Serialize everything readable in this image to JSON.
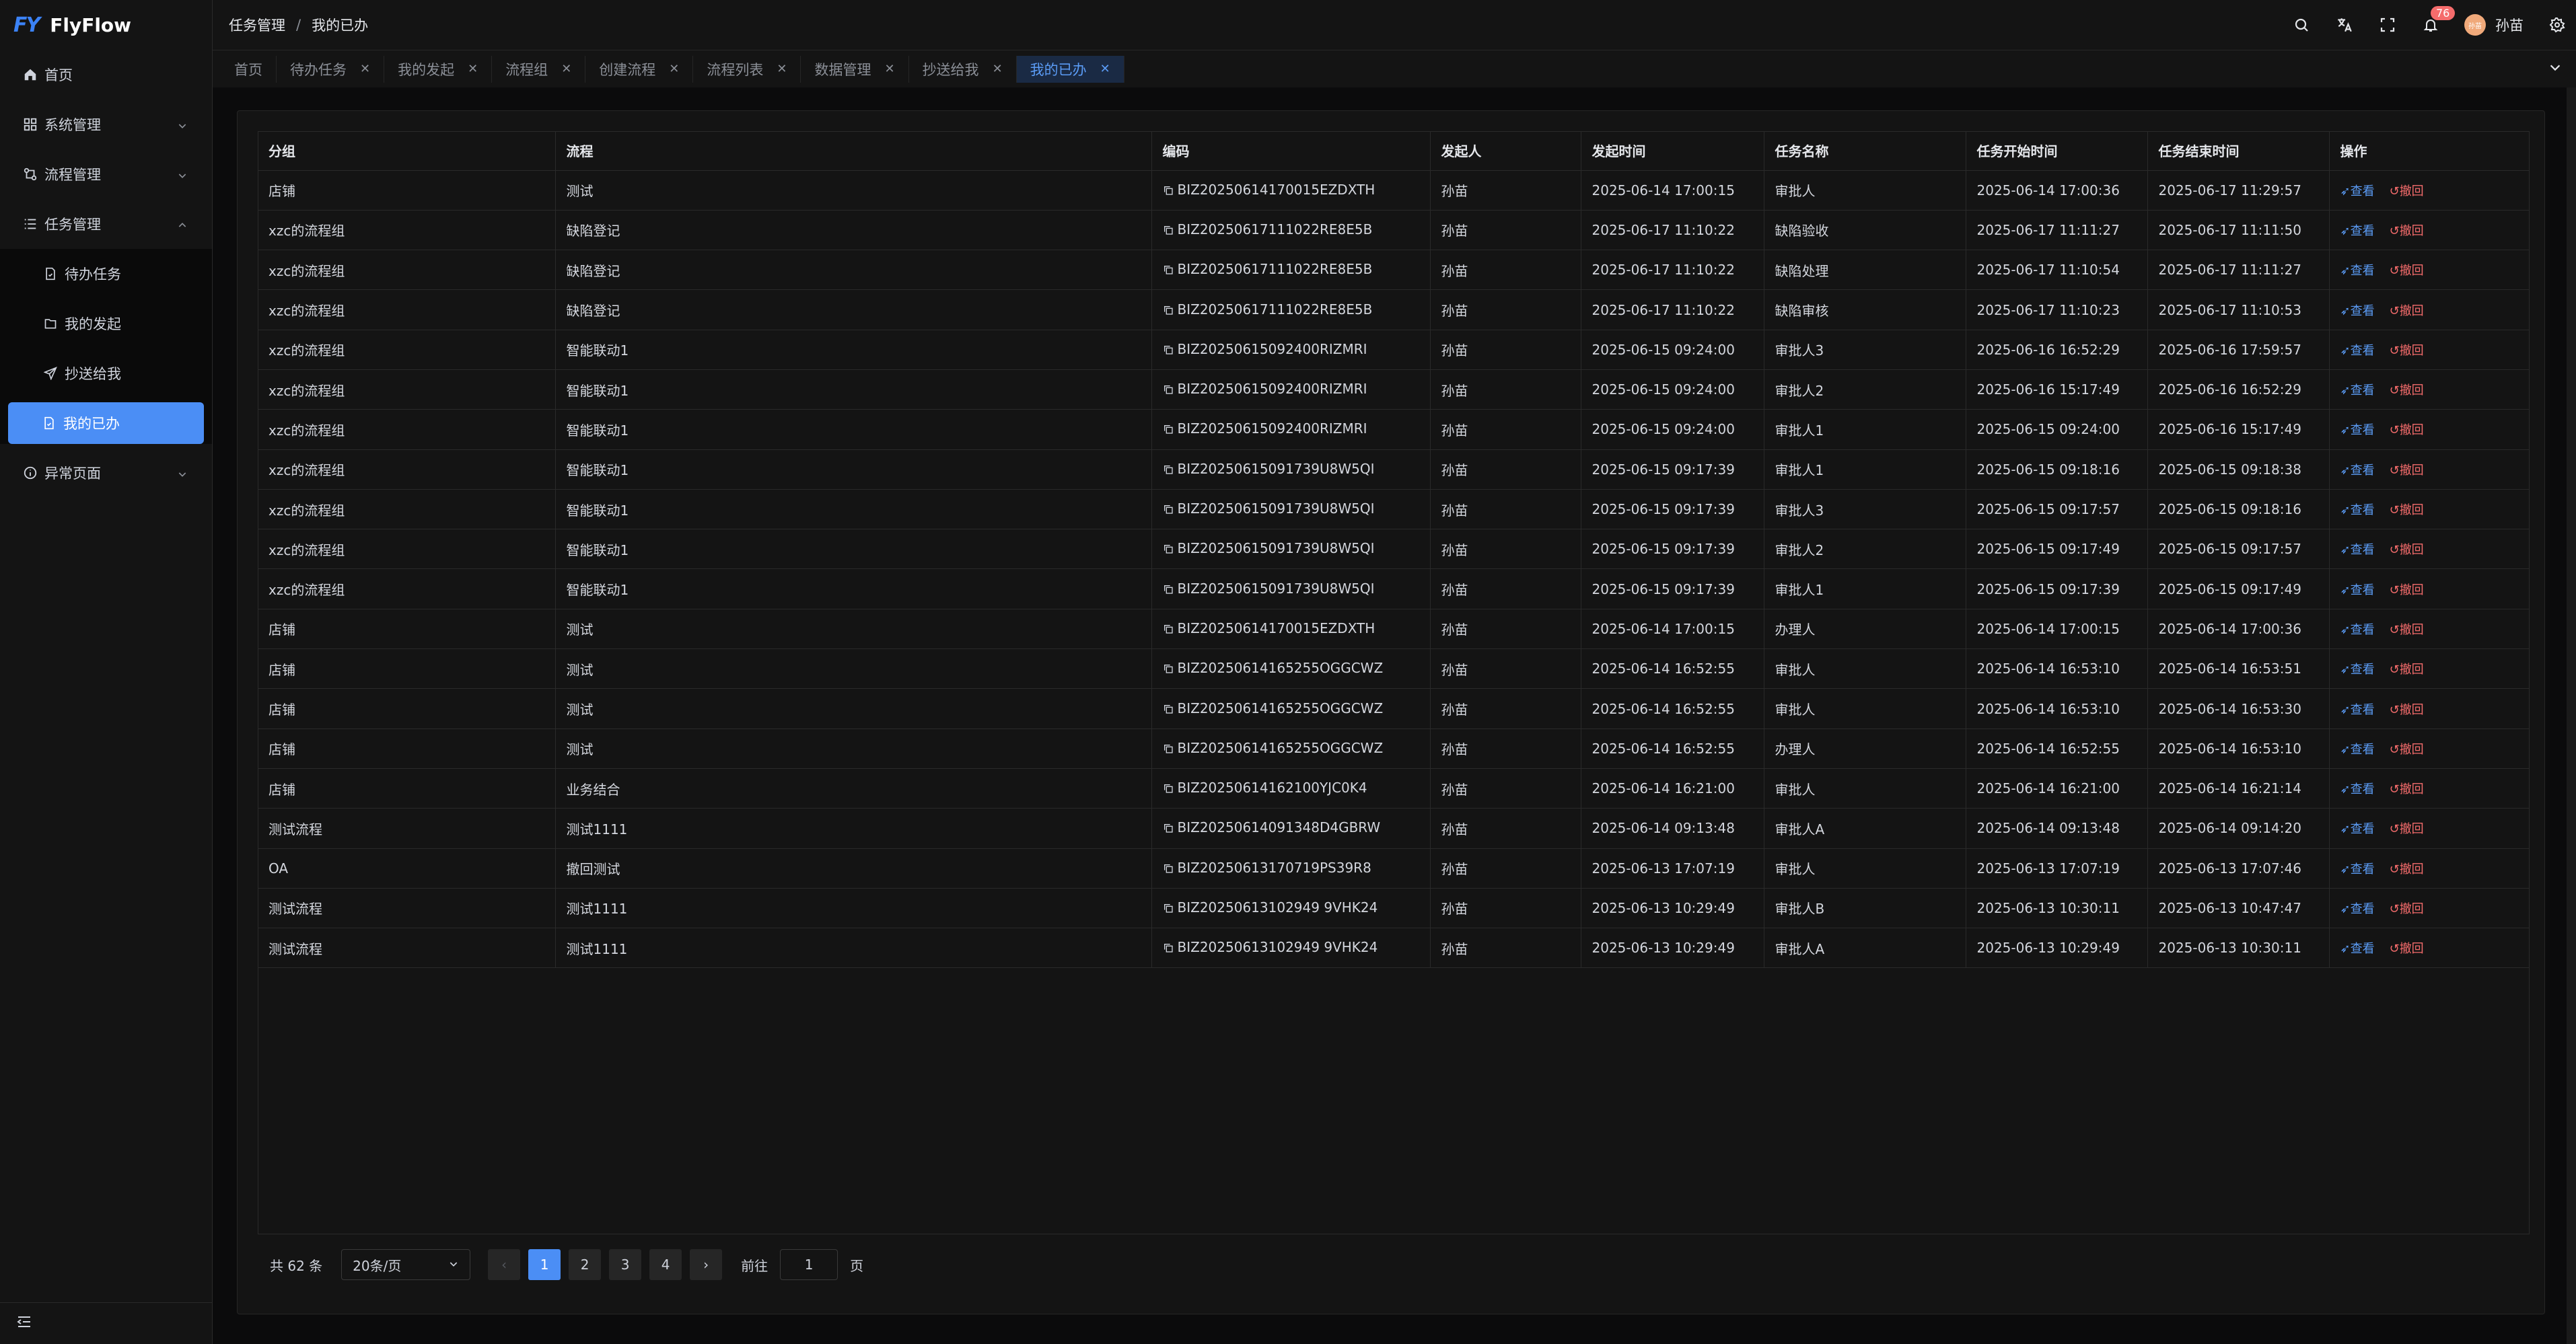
{
  "app": {
    "logo_mark": "FY",
    "name": "FlyFlow"
  },
  "sidebar": {
    "items": [
      {
        "label": "首页"
      },
      {
        "label": "系统管理"
      },
      {
        "label": "流程管理"
      },
      {
        "label": "任务管理"
      },
      {
        "label": "异常页面"
      }
    ],
    "task_sub": [
      {
        "label": "待办任务"
      },
      {
        "label": "我的发起"
      },
      {
        "label": "抄送给我"
      },
      {
        "label": "我的已办"
      }
    ]
  },
  "header": {
    "breadcrumb": [
      "任务管理",
      "我的已办"
    ],
    "separator": "/",
    "notification_count": "76",
    "avatar_text": "孙苗",
    "user_name": "孙苗"
  },
  "tabs": [
    {
      "label": "首页",
      "closable": false
    },
    {
      "label": "待办任务",
      "closable": true
    },
    {
      "label": "我的发起",
      "closable": true
    },
    {
      "label": "流程组",
      "closable": true
    },
    {
      "label": "创建流程",
      "closable": true
    },
    {
      "label": "流程列表",
      "closable": true
    },
    {
      "label": "数据管理",
      "closable": true
    },
    {
      "label": "抄送给我",
      "closable": true
    },
    {
      "label": "我的已办",
      "closable": true
    }
  ],
  "table": {
    "columns": [
      "分组",
      "流程",
      "编码",
      "发起人",
      "发起时间",
      "任务名称",
      "任务开始时间",
      "任务结束时间",
      "操作"
    ],
    "action_view": "查看",
    "action_revoke": "撤回",
    "rows": [
      [
        "店铺",
        "测试",
        "BIZ20250614170015EZDXTH",
        "孙苗",
        "2025-06-14 17:00:15",
        "审批人",
        "2025-06-14 17:00:36",
        "2025-06-17 11:29:57"
      ],
      [
        "xzc的流程组",
        "缺陷登记",
        "BIZ20250617111022RE8E5B",
        "孙苗",
        "2025-06-17 11:10:22",
        "缺陷验收",
        "2025-06-17 11:11:27",
        "2025-06-17 11:11:50"
      ],
      [
        "xzc的流程组",
        "缺陷登记",
        "BIZ20250617111022RE8E5B",
        "孙苗",
        "2025-06-17 11:10:22",
        "缺陷处理",
        "2025-06-17 11:10:54",
        "2025-06-17 11:11:27"
      ],
      [
        "xzc的流程组",
        "缺陷登记",
        "BIZ20250617111022RE8E5B",
        "孙苗",
        "2025-06-17 11:10:22",
        "缺陷审核",
        "2025-06-17 11:10:23",
        "2025-06-17 11:10:53"
      ],
      [
        "xzc的流程组",
        "智能联动1",
        "BIZ20250615092400RIZMRI",
        "孙苗",
        "2025-06-15 09:24:00",
        "审批人3",
        "2025-06-16 16:52:29",
        "2025-06-16 17:59:57"
      ],
      [
        "xzc的流程组",
        "智能联动1",
        "BIZ20250615092400RIZMRI",
        "孙苗",
        "2025-06-15 09:24:00",
        "审批人2",
        "2025-06-16 15:17:49",
        "2025-06-16 16:52:29"
      ],
      [
        "xzc的流程组",
        "智能联动1",
        "BIZ20250615092400RIZMRI",
        "孙苗",
        "2025-06-15 09:24:00",
        "审批人1",
        "2025-06-15 09:24:00",
        "2025-06-16 15:17:49"
      ],
      [
        "xzc的流程组",
        "智能联动1",
        "BIZ20250615091739U8W5QI",
        "孙苗",
        "2025-06-15 09:17:39",
        "审批人1",
        "2025-06-15 09:18:16",
        "2025-06-15 09:18:38"
      ],
      [
        "xzc的流程组",
        "智能联动1",
        "BIZ20250615091739U8W5QI",
        "孙苗",
        "2025-06-15 09:17:39",
        "审批人3",
        "2025-06-15 09:17:57",
        "2025-06-15 09:18:16"
      ],
      [
        "xzc的流程组",
        "智能联动1",
        "BIZ20250615091739U8W5QI",
        "孙苗",
        "2025-06-15 09:17:39",
        "审批人2",
        "2025-06-15 09:17:49",
        "2025-06-15 09:17:57"
      ],
      [
        "xzc的流程组",
        "智能联动1",
        "BIZ20250615091739U8W5QI",
        "孙苗",
        "2025-06-15 09:17:39",
        "审批人1",
        "2025-06-15 09:17:39",
        "2025-06-15 09:17:49"
      ],
      [
        "店铺",
        "测试",
        "BIZ20250614170015EZDXTH",
        "孙苗",
        "2025-06-14 17:00:15",
        "办理人",
        "2025-06-14 17:00:15",
        "2025-06-14 17:00:36"
      ],
      [
        "店铺",
        "测试",
        "BIZ20250614165255OGGCWZ",
        "孙苗",
        "2025-06-14 16:52:55",
        "审批人",
        "2025-06-14 16:53:10",
        "2025-06-14 16:53:51"
      ],
      [
        "店铺",
        "测试",
        "BIZ20250614165255OGGCWZ",
        "孙苗",
        "2025-06-14 16:52:55",
        "审批人",
        "2025-06-14 16:53:10",
        "2025-06-14 16:53:30"
      ],
      [
        "店铺",
        "测试",
        "BIZ20250614165255OGGCWZ",
        "孙苗",
        "2025-06-14 16:52:55",
        "办理人",
        "2025-06-14 16:52:55",
        "2025-06-14 16:53:10"
      ],
      [
        "店铺",
        "业务结合",
        "BIZ20250614162100YJC0K4",
        "孙苗",
        "2025-06-14 16:21:00",
        "审批人",
        "2025-06-14 16:21:00",
        "2025-06-14 16:21:14"
      ],
      [
        "测试流程",
        "测试1111",
        "BIZ20250614091348D4GBRW",
        "孙苗",
        "2025-06-14 09:13:48",
        "审批人A",
        "2025-06-14 09:13:48",
        "2025-06-14 09:14:20"
      ],
      [
        "OA",
        "撤回测试",
        "BIZ20250613170719PS39R8",
        "孙苗",
        "2025-06-13 17:07:19",
        "审批人",
        "2025-06-13 17:07:19",
        "2025-06-13 17:07:46"
      ],
      [
        "测试流程",
        "测试1111",
        "BIZ20250613102949 9VHK24",
        "孙苗",
        "2025-06-13 10:29:49",
        "审批人B",
        "2025-06-13 10:30:11",
        "2025-06-13 10:47:47"
      ],
      [
        "测试流程",
        "测试1111",
        "BIZ20250613102949 9VHK24",
        "孙苗",
        "2025-06-13 10:29:49",
        "审批人A",
        "2025-06-13 10:29:49",
        "2025-06-13 10:30:11"
      ]
    ]
  },
  "pagination": {
    "total_text": "共 62 条",
    "page_size": "20条/页",
    "pages": [
      "1",
      "2",
      "3",
      "4"
    ],
    "current_page": "1",
    "goto_label": "前往",
    "goto_value": "1",
    "page_suffix": "页"
  },
  "colors": {
    "accent": "#4b8ef5",
    "danger": "#f56c6c",
    "background": "#0b0b0c",
    "panel": "#141414"
  }
}
